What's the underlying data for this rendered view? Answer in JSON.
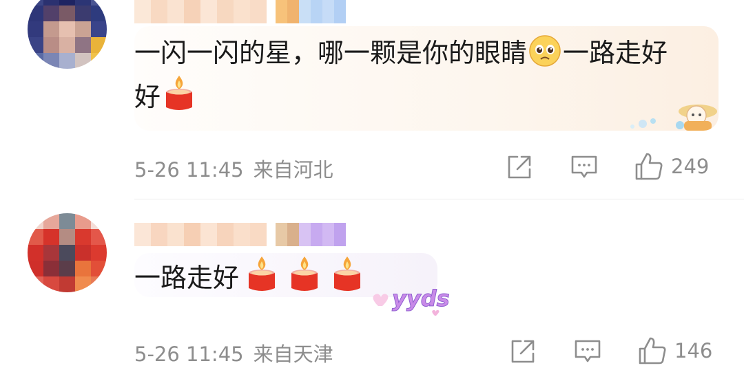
{
  "comments": [
    {
      "text_line1": "一闪一闪的星，哪一颗是你的眼睛",
      "text_line1_end": "一路走好",
      "text_line2": "好",
      "date": "5-26 11:45",
      "location": "来自河北",
      "like_count": "249",
      "bubble_sticker": "girl-with-hat-sticker",
      "avatar_color": "#2a2f6e"
    },
    {
      "text": "一路走好",
      "candle_count": 3,
      "date": "5-26 11:45",
      "location": "来自天津",
      "like_count": "146",
      "bubble_sticker": "yyds-sticker",
      "sticker_text": "yyds",
      "avatar_color": "#d8342e"
    }
  ],
  "icons": {
    "share": "share-icon",
    "reply": "comment-icon",
    "like": "thumbs-up-icon",
    "candle": "candle-emoji-icon",
    "face": "pleading-face-emoji-icon"
  },
  "colors": {
    "meta": "#8d8d8d",
    "text": "#1a1a1a",
    "bubble1": "#fdf4ea",
    "bubble2": "#f5f3f8"
  }
}
